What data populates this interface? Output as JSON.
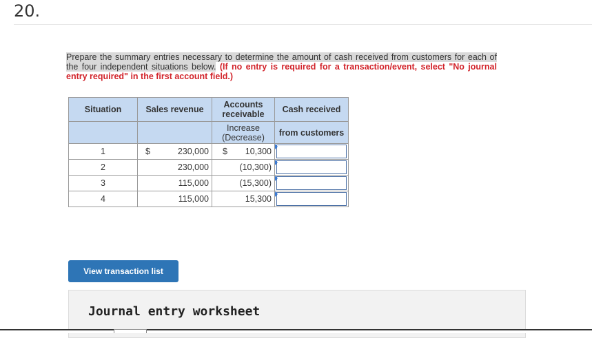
{
  "question_number": "20.",
  "instructions": {
    "plain": "Prepare the summary entries necessary to determine the amount of cash received from customers for each of the four independent situations below.",
    "red": "(If no entry is required for a transaction/event, select \"No journal entry required\" in the first account field.)"
  },
  "table": {
    "headers": {
      "situation": "Situation",
      "sales_revenue": "Sales revenue",
      "ar_line1": "Accounts",
      "ar_line2": "receivable",
      "cash_received": "Cash received",
      "ar_sub_line1": "Increase",
      "ar_sub_line2": "(Decrease)",
      "cash_sub": "from customers"
    },
    "rows": [
      {
        "situation": "1",
        "rev_dollar": "$",
        "sales_revenue": "230,000",
        "ar_dollar": "$",
        "ar": "10,300",
        "cash": ""
      },
      {
        "situation": "2",
        "rev_dollar": "",
        "sales_revenue": "230,000",
        "ar_dollar": "",
        "ar": "(10,300)",
        "cash": ""
      },
      {
        "situation": "3",
        "rev_dollar": "",
        "sales_revenue": "115,000",
        "ar_dollar": "",
        "ar": "(15,300)",
        "cash": ""
      },
      {
        "situation": "4",
        "rev_dollar": "",
        "sales_revenue": "115,000",
        "ar_dollar": "",
        "ar": "15,300",
        "cash": ""
      }
    ]
  },
  "buttons": {
    "view_transactions": "View transaction list"
  },
  "worksheet": {
    "title": "Journal entry worksheet"
  },
  "colors": {
    "header_bg": "#c5d9f1",
    "button_bg": "#2e75b6",
    "instruction_red": "#d2232a"
  }
}
